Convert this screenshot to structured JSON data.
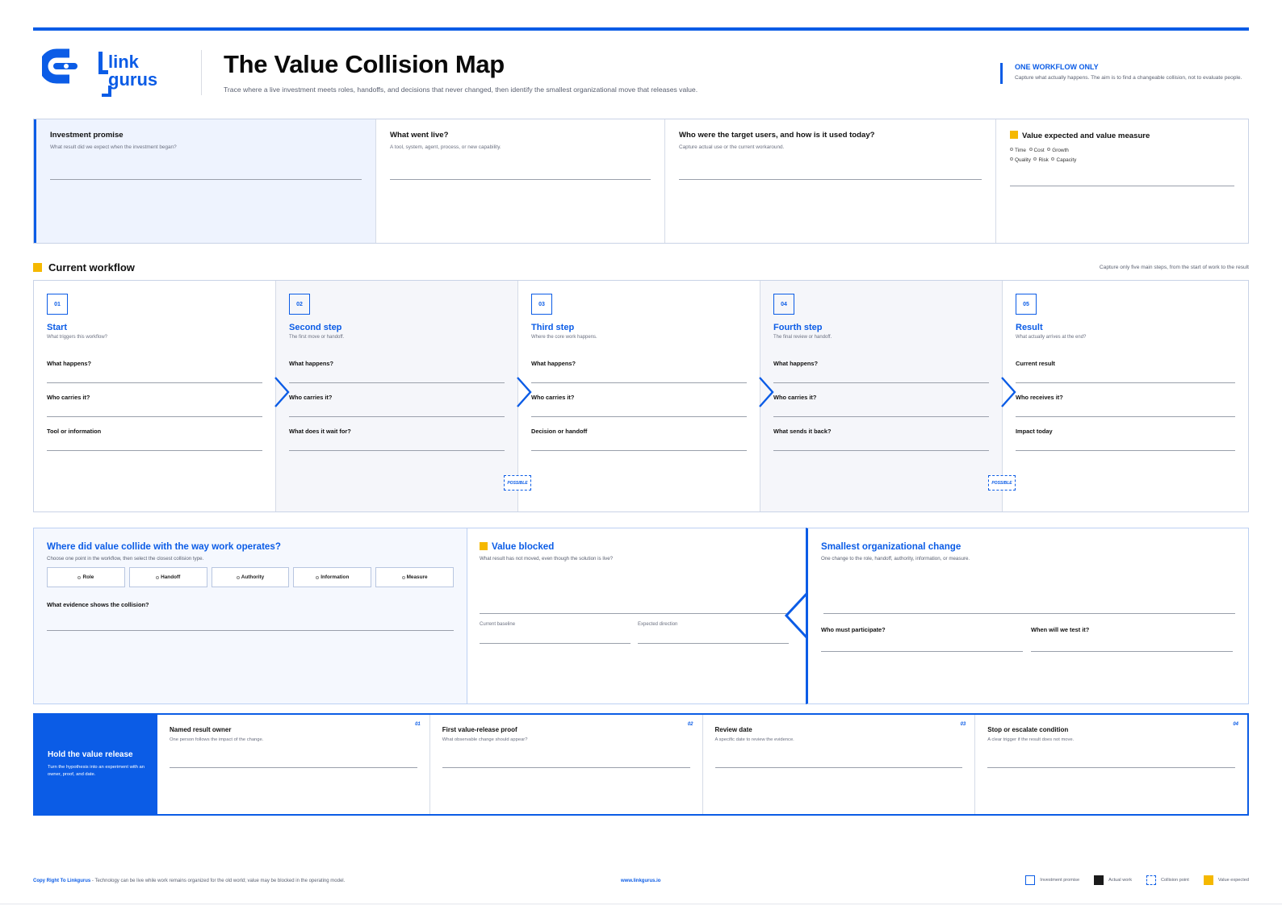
{
  "header": {
    "brand_line1": "link",
    "brand_line2": "gurus",
    "title": "The Value Collision Map",
    "subtitle": "Trace where a live investment meets roles, handoffs, and decisions that never changed, then identify the smallest organizational move that releases value.",
    "notice_title": "ONE WORKFLOW ONLY",
    "notice_text": "Capture what actually happens. The aim is to find a changeable collision, not to evaluate people."
  },
  "top": {
    "investment": {
      "title": "Investment promise",
      "hint": "What result did we expect when the investment began?"
    },
    "went_live": {
      "title": "What went live?",
      "hint": "A tool, system, agent, process, or new capability."
    },
    "users": {
      "title": "Who were the target users, and how is it used today?",
      "hint": "Capture actual use or the current workaround."
    },
    "value": {
      "title": "Value expected and value measure",
      "options": [
        "Time",
        "Cost",
        "Growth",
        "Quality",
        "Risk",
        "Capacity"
      ]
    }
  },
  "workflow": {
    "title": "Current workflow",
    "note": "Capture only five main steps, from the start of work to the result",
    "steps": [
      {
        "num": "01",
        "title": "Start",
        "hint": "What triggers this workflow?",
        "q1": "What happens?",
        "q2": "Who carries it?",
        "q3": "Tool or information"
      },
      {
        "num": "02",
        "title": "Second step",
        "hint": "The first move or handoff.",
        "q1": "What happens?",
        "q2": "Who carries it?",
        "q3": "What does it wait for?"
      },
      {
        "num": "03",
        "title": "Third step",
        "hint": "Where the core work happens.",
        "q1": "What happens?",
        "q2": "Who carries it?",
        "q3": "Decision or handoff"
      },
      {
        "num": "04",
        "title": "Fourth step",
        "hint": "The final review or handoff.",
        "q1": "What happens?",
        "q2": "Who carries it?",
        "q3": "What sends it back?"
      },
      {
        "num": "05",
        "title": "Result",
        "hint": "What actually arrives at the end?",
        "q1": "Current result",
        "q2": "Who receives it?",
        "q3": "Impact today"
      }
    ],
    "possible_label": "POSSIBLE"
  },
  "collision": {
    "title": "Where did value collide with the way work operates?",
    "hint": "Choose one point in the workflow, then select the closest collision type.",
    "types": [
      "Role",
      "Handoff",
      "Authority",
      "Information",
      "Measure"
    ],
    "evidence": "What evidence shows the collision?"
  },
  "blocked": {
    "title": "Value blocked",
    "hint": "What result has not moved, even though the solution is live?",
    "baseline": "Current baseline",
    "direction": "Expected direction"
  },
  "change": {
    "title": "Smallest organizational change",
    "hint": "One change to the role, handoff, authority, information, or measure.",
    "participate": "Who must participate?",
    "test": "When will we test it?"
  },
  "hold": {
    "title": "Hold the value release",
    "text": "Turn the hypothesis into an experiment with an owner, proof, and date.",
    "cells": [
      {
        "num": "01",
        "title": "Named result owner",
        "hint": "One person follows the impact of the change."
      },
      {
        "num": "02",
        "title": "First value-release proof",
        "hint": "What observable change should appear?"
      },
      {
        "num": "03",
        "title": "Review date",
        "hint": "A specific date to review the evidence."
      },
      {
        "num": "04",
        "title": "Stop or escalate condition",
        "hint": "A clear trigger if the result does not move."
      }
    ]
  },
  "footer": {
    "copyright": "Copy Right To Linkgurus",
    "tagline": " - Technology can be live while work remains organized for the old world; value may be blocked in the operating model.",
    "url": "www.linkgurus.io",
    "legend": [
      "Investment promise",
      "Actual work",
      "Collision point",
      "Value expected"
    ]
  },
  "colors": {
    "accent": "#0b5ce6",
    "highlight": "#f5b800",
    "tint": "#eef3fe"
  }
}
